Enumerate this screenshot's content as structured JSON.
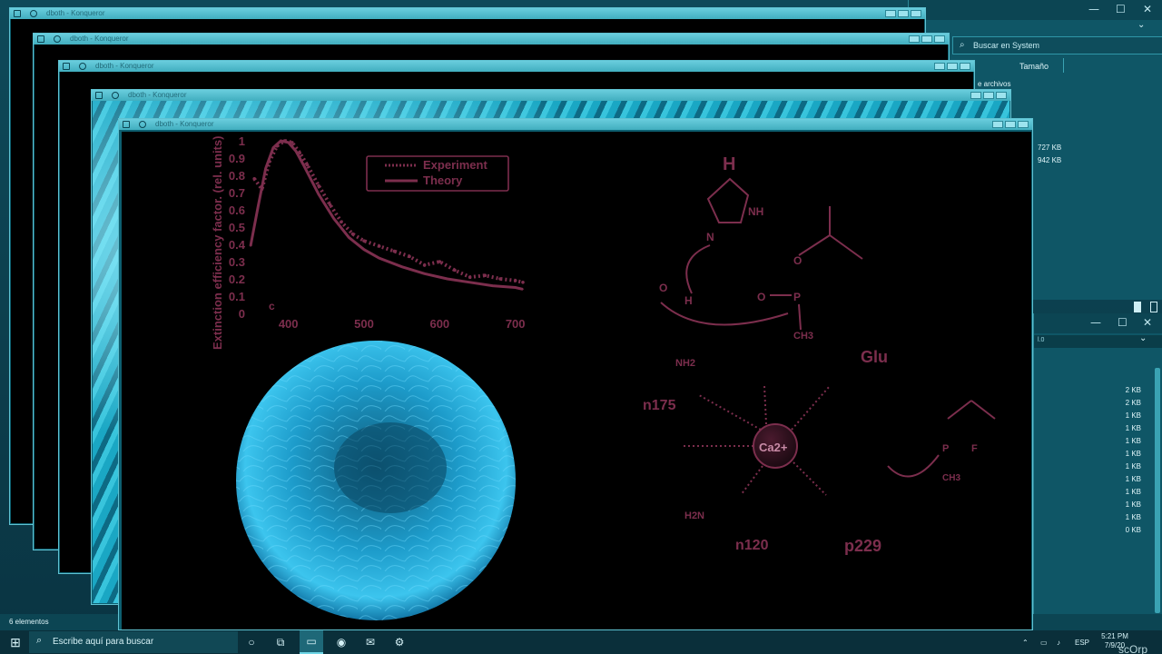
{
  "explorer": {
    "search_placeholder": "Buscar en System",
    "column_size": "Tamaño",
    "archivos_label": "e archivos",
    "top_sizes": [
      "727 KB",
      "942 KB"
    ],
    "sizes": [
      "2 KB",
      "2 KB",
      "1 KB",
      "1 KB",
      "1 KB",
      "1 KB",
      "1 KB",
      "1 KB",
      "1 KB",
      "1 KB",
      "1 KB",
      "0 KB"
    ],
    "address_fragment": "l.0"
  },
  "statusbar": {
    "count": "6 elementos"
  },
  "konqueror": {
    "title": "dboth - Konqueror"
  },
  "figure": {
    "ylabel": "Extinction efficiency factor. (rel. units)",
    "legend": [
      "Experiment",
      "Theory"
    ],
    "yticks": [
      "1",
      "0.9",
      "0.8",
      "0.7",
      "0.6",
      "0.5",
      "0.4",
      "0.3",
      "0.2",
      "0.1",
      "0"
    ],
    "xticks": [
      "400",
      "500",
      "600",
      "700"
    ],
    "corner_label": "c"
  },
  "chart_data": {
    "type": "line",
    "ylabel": "Extinction efficiency factor. (rel. units)",
    "xlabel": "",
    "xlim": [
      350,
      710
    ],
    "ylim": [
      0,
      1
    ],
    "series": [
      {
        "name": "Experiment",
        "x": [
          355,
          365,
          375,
          385,
          395,
          405,
          415,
          425,
          440,
          455,
          470,
          485,
          500,
          520,
          540,
          560,
          580,
          600,
          620,
          640,
          660,
          680,
          700,
          710
        ],
        "y": [
          0.78,
          0.72,
          0.88,
          0.97,
          1.0,
          0.99,
          0.93,
          0.86,
          0.74,
          0.63,
          0.53,
          0.46,
          0.42,
          0.39,
          0.36,
          0.33,
          0.28,
          0.3,
          0.25,
          0.21,
          0.22,
          0.2,
          0.19,
          0.18
        ]
      },
      {
        "name": "Theory",
        "x": [
          350,
          360,
          370,
          380,
          390,
          400,
          410,
          420,
          440,
          460,
          480,
          500,
          520,
          550,
          580,
          610,
          640,
          670,
          700,
          710
        ],
        "y": [
          0.39,
          0.62,
          0.84,
          0.96,
          1.0,
          0.99,
          0.94,
          0.86,
          0.69,
          0.55,
          0.44,
          0.37,
          0.32,
          0.27,
          0.23,
          0.2,
          0.18,
          0.16,
          0.15,
          0.14
        ]
      }
    ]
  },
  "molecule": {
    "atoms_top": [
      "H",
      "NH",
      "N",
      "O",
      "H",
      "O",
      "O",
      "P",
      "CH3"
    ],
    "center": "Ca2+",
    "labels": [
      "Glu",
      "n175",
      "n120",
      "p229"
    ],
    "nh2": "NH2",
    "h2n": "H2N",
    "f": "F",
    "ch3_right": "CH3"
  },
  "taskbar": {
    "search_placeholder": "Escribe aquí para buscar",
    "language": "ESP",
    "time": "5:21 PM",
    "date": "7/9/20",
    "watermark": "scOrp"
  },
  "colors": {
    "plot": "#7c2e4d",
    "desktop": "#0e4a5a",
    "cell": "#26b3d6"
  }
}
